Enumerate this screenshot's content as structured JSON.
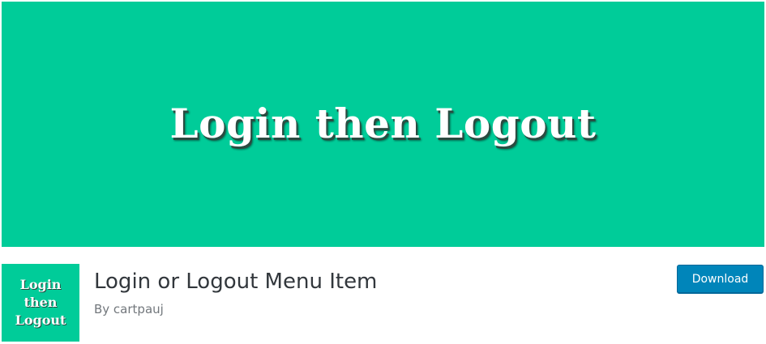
{
  "banner": {
    "text": "Login then Logout",
    "background_color": "#00cc99"
  },
  "icon": {
    "lines": [
      "Login",
      "then",
      "Logout"
    ],
    "background_color": "#00cc99"
  },
  "plugin": {
    "title": "Login or Logout Menu Item",
    "author": "By cartpauj"
  },
  "actions": {
    "download_label": "Download",
    "accent_color": "#0085ba"
  }
}
